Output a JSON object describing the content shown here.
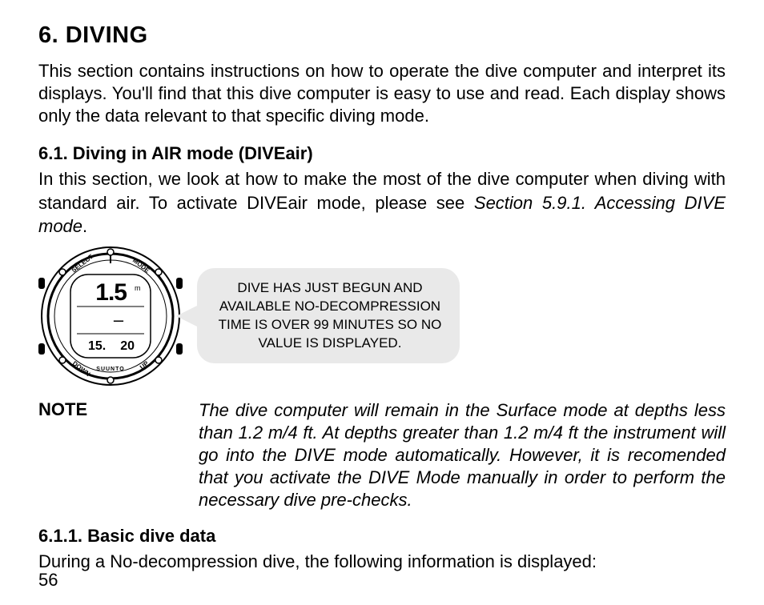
{
  "chapter": {
    "title": "6. DIVING"
  },
  "intro": "This section contains instructions on how to operate the dive computer and interpret its displays. You'll find that this dive computer is easy to use and read. Each display shows only the data relevant to that specific diving mode.",
  "section61": {
    "heading": "6.1. Diving in AIR mode (DIVEair)",
    "text_pre": "In this section, we look at how to make the most of the dive computer when diving with standard air. To activate DIVEair mode, please see ",
    "text_ref": "Section 5.9.1. Accessing DIVE mode",
    "text_post": "."
  },
  "watch": {
    "label_select": "SELECT",
    "label_mode": "MODE",
    "label_down": "DOWN",
    "label_up": "UP",
    "brand": "SUUNTO",
    "display_top": "1.5",
    "display_mid": "–",
    "display_bl": "15.",
    "display_br": "20",
    "m_marker": "m"
  },
  "callout": {
    "text": "DIVE HAS JUST BEGUN AND AVAILABLE NO-DECOMPRESSION TIME IS OVER 99 MINUTES SO NO VALUE IS DISPLAYED."
  },
  "note": {
    "label": "NOTE",
    "body": "The dive computer will remain in the Surface mode at depths less than 1.2 m/4 ft. At depths greater than 1.2 m/4 ft the instrument will go into the DIVE mode automatically. However, it is recomended that you activate the DIVE Mode manually in order to perform the necessary dive pre-checks."
  },
  "section611": {
    "heading": "6.1.1. Basic dive data",
    "text": "During a No-decompression dive, the following information is displayed:"
  },
  "page_number": "56"
}
